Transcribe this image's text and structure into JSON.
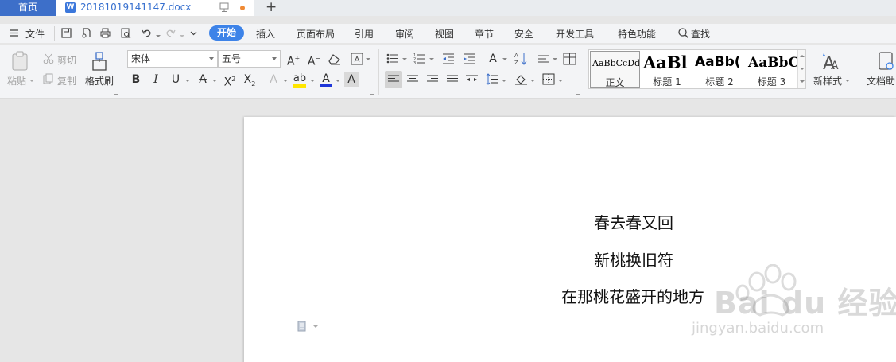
{
  "tabs": {
    "home_label": "首页",
    "doc_title": "20181019141147.docx",
    "add_label": "+"
  },
  "menu": {
    "file_label": "文件",
    "items": [
      "开始",
      "插入",
      "页面布局",
      "引用",
      "审阅",
      "视图",
      "章节",
      "安全",
      "开发工具",
      "特色功能"
    ],
    "search_label": "查找"
  },
  "ribbon": {
    "paste_label": "粘贴",
    "cut_label": "剪切",
    "copy_label": "复制",
    "format_painter_label": "格式刷",
    "font_name": "宋体",
    "font_size": "五号",
    "new_style_label": "新样式",
    "doc_helper_label": "文档助",
    "styles": [
      {
        "preview": "AaBbCcDd",
        "name": "正文"
      },
      {
        "preview": "AaBl",
        "name": "标题 1"
      },
      {
        "preview": "AaBb(",
        "name": "标题 2"
      },
      {
        "preview": "AaBbC",
        "name": "标题 3"
      }
    ]
  },
  "document": {
    "lines": [
      "春去春又回",
      "新桃换旧符",
      "在那桃花盛开的地方"
    ]
  },
  "watermark": {
    "main": "Bai du 经验",
    "sub": "jingyan.baidu.com"
  },
  "colors": {
    "accent": "#3d83e8",
    "home_tab": "#3d6fc9",
    "doc_tab_text": "#3770cf",
    "modified_dot": "#f08a34",
    "highlight_yellow": "#ffe600",
    "font_color_blue": "#1e36d9"
  }
}
